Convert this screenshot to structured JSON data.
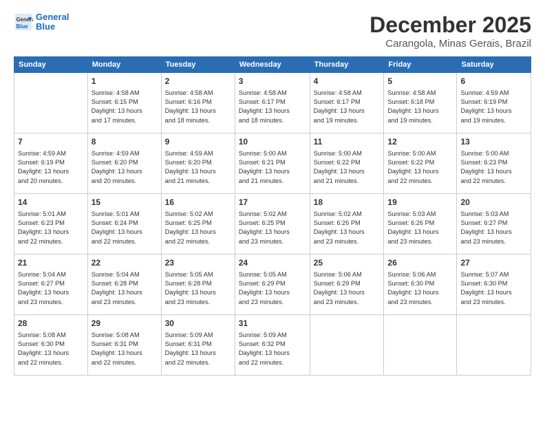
{
  "logo": {
    "line1": "General",
    "line2": "Blue"
  },
  "title": "December 2025",
  "subtitle": "Carangola, Minas Gerais, Brazil",
  "days_of_week": [
    "Sunday",
    "Monday",
    "Tuesday",
    "Wednesday",
    "Thursday",
    "Friday",
    "Saturday"
  ],
  "weeks": [
    [
      {
        "day": "",
        "content": ""
      },
      {
        "day": "1",
        "content": "Sunrise: 4:58 AM\nSunset: 6:15 PM\nDaylight: 13 hours\nand 17 minutes."
      },
      {
        "day": "2",
        "content": "Sunrise: 4:58 AM\nSunset: 6:16 PM\nDaylight: 13 hours\nand 18 minutes."
      },
      {
        "day": "3",
        "content": "Sunrise: 4:58 AM\nSunset: 6:17 PM\nDaylight: 13 hours\nand 18 minutes."
      },
      {
        "day": "4",
        "content": "Sunrise: 4:58 AM\nSunset: 6:17 PM\nDaylight: 13 hours\nand 19 minutes."
      },
      {
        "day": "5",
        "content": "Sunrise: 4:58 AM\nSunset: 6:18 PM\nDaylight: 13 hours\nand 19 minutes."
      },
      {
        "day": "6",
        "content": "Sunrise: 4:59 AM\nSunset: 6:19 PM\nDaylight: 13 hours\nand 19 minutes."
      }
    ],
    [
      {
        "day": "7",
        "content": "Sunrise: 4:59 AM\nSunset: 6:19 PM\nDaylight: 13 hours\nand 20 minutes."
      },
      {
        "day": "8",
        "content": "Sunrise: 4:59 AM\nSunset: 6:20 PM\nDaylight: 13 hours\nand 20 minutes."
      },
      {
        "day": "9",
        "content": "Sunrise: 4:59 AM\nSunset: 6:20 PM\nDaylight: 13 hours\nand 21 minutes."
      },
      {
        "day": "10",
        "content": "Sunrise: 5:00 AM\nSunset: 6:21 PM\nDaylight: 13 hours\nand 21 minutes."
      },
      {
        "day": "11",
        "content": "Sunrise: 5:00 AM\nSunset: 6:22 PM\nDaylight: 13 hours\nand 21 minutes."
      },
      {
        "day": "12",
        "content": "Sunrise: 5:00 AM\nSunset: 6:22 PM\nDaylight: 13 hours\nand 22 minutes."
      },
      {
        "day": "13",
        "content": "Sunrise: 5:00 AM\nSunset: 6:23 PM\nDaylight: 13 hours\nand 22 minutes."
      }
    ],
    [
      {
        "day": "14",
        "content": "Sunrise: 5:01 AM\nSunset: 6:23 PM\nDaylight: 13 hours\nand 22 minutes."
      },
      {
        "day": "15",
        "content": "Sunrise: 5:01 AM\nSunset: 6:24 PM\nDaylight: 13 hours\nand 22 minutes."
      },
      {
        "day": "16",
        "content": "Sunrise: 5:02 AM\nSunset: 6:25 PM\nDaylight: 13 hours\nand 22 minutes."
      },
      {
        "day": "17",
        "content": "Sunrise: 5:02 AM\nSunset: 6:25 PM\nDaylight: 13 hours\nand 23 minutes."
      },
      {
        "day": "18",
        "content": "Sunrise: 5:02 AM\nSunset: 6:26 PM\nDaylight: 13 hours\nand 23 minutes."
      },
      {
        "day": "19",
        "content": "Sunrise: 5:03 AM\nSunset: 6:26 PM\nDaylight: 13 hours\nand 23 minutes."
      },
      {
        "day": "20",
        "content": "Sunrise: 5:03 AM\nSunset: 6:27 PM\nDaylight: 13 hours\nand 23 minutes."
      }
    ],
    [
      {
        "day": "21",
        "content": "Sunrise: 5:04 AM\nSunset: 6:27 PM\nDaylight: 13 hours\nand 23 minutes."
      },
      {
        "day": "22",
        "content": "Sunrise: 5:04 AM\nSunset: 6:28 PM\nDaylight: 13 hours\nand 23 minutes."
      },
      {
        "day": "23",
        "content": "Sunrise: 5:05 AM\nSunset: 6:28 PM\nDaylight: 13 hours\nand 23 minutes."
      },
      {
        "day": "24",
        "content": "Sunrise: 5:05 AM\nSunset: 6:29 PM\nDaylight: 13 hours\nand 23 minutes."
      },
      {
        "day": "25",
        "content": "Sunrise: 5:06 AM\nSunset: 6:29 PM\nDaylight: 13 hours\nand 23 minutes."
      },
      {
        "day": "26",
        "content": "Sunrise: 5:06 AM\nSunset: 6:30 PM\nDaylight: 13 hours\nand 23 minutes."
      },
      {
        "day": "27",
        "content": "Sunrise: 5:07 AM\nSunset: 6:30 PM\nDaylight: 13 hours\nand 23 minutes."
      }
    ],
    [
      {
        "day": "28",
        "content": "Sunrise: 5:08 AM\nSunset: 6:30 PM\nDaylight: 13 hours\nand 22 minutes."
      },
      {
        "day": "29",
        "content": "Sunrise: 5:08 AM\nSunset: 6:31 PM\nDaylight: 13 hours\nand 22 minutes."
      },
      {
        "day": "30",
        "content": "Sunrise: 5:09 AM\nSunset: 6:31 PM\nDaylight: 13 hours\nand 22 minutes."
      },
      {
        "day": "31",
        "content": "Sunrise: 5:09 AM\nSunset: 6:32 PM\nDaylight: 13 hours\nand 22 minutes."
      },
      {
        "day": "",
        "content": ""
      },
      {
        "day": "",
        "content": ""
      },
      {
        "day": "",
        "content": ""
      }
    ]
  ]
}
